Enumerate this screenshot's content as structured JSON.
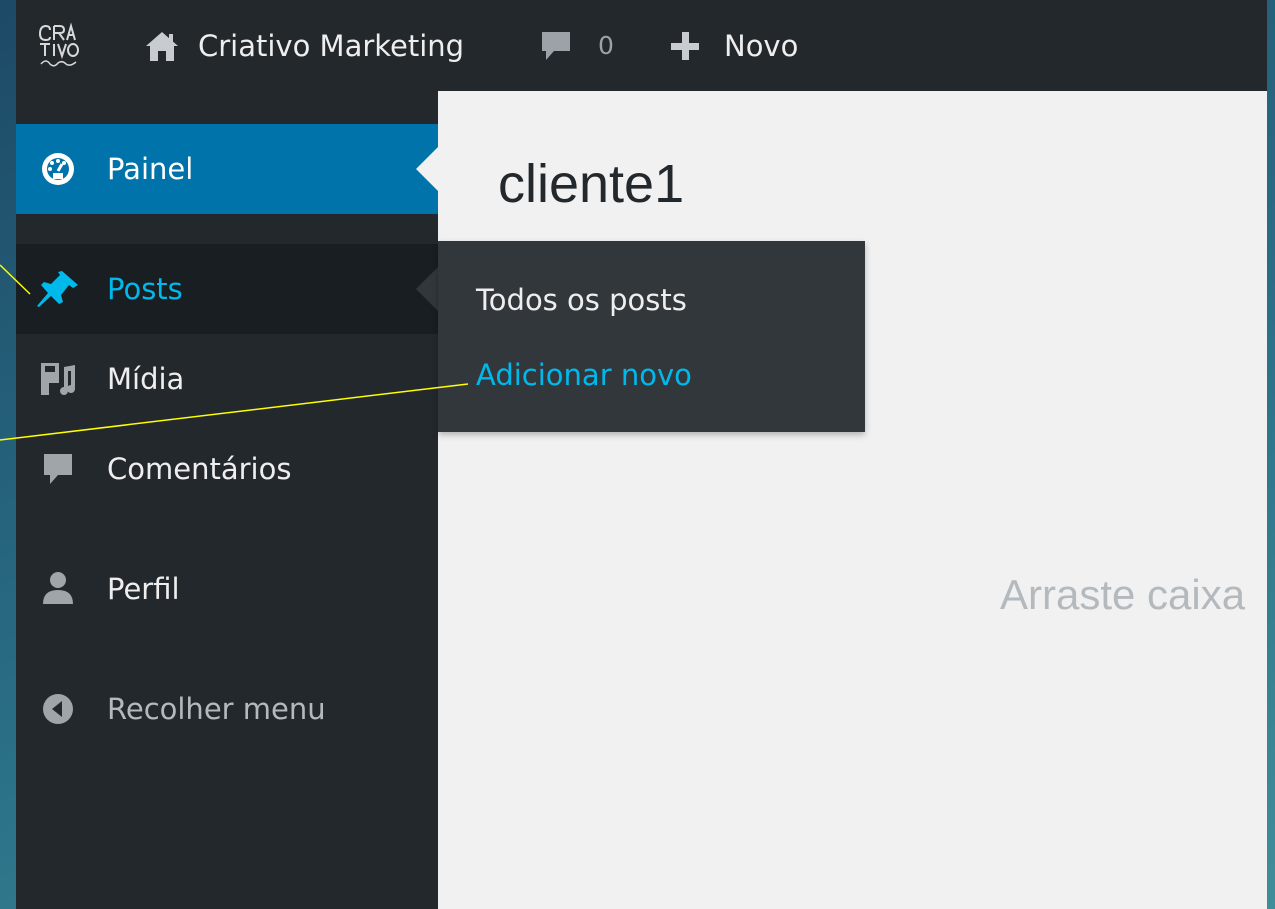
{
  "adminbar": {
    "logo_icon": "criativo-logo-icon",
    "site_name": "Criativo Marketing",
    "comments_count": "0",
    "new_label": "Novo"
  },
  "sidebar": {
    "items": [
      {
        "key": "painel",
        "label": "Painel",
        "icon": "dashboard-icon"
      },
      {
        "key": "posts",
        "label": "Posts",
        "icon": "pushpin-icon"
      },
      {
        "key": "midia",
        "label": "Mídia",
        "icon": "media-icon"
      },
      {
        "key": "comentarios",
        "label": "Comentários",
        "icon": "comment-icon"
      },
      {
        "key": "perfil",
        "label": "Perfil",
        "icon": "user-icon"
      },
      {
        "key": "recolher",
        "label": "Recolher menu",
        "icon": "collapse-icon"
      }
    ]
  },
  "flyout": {
    "items": [
      {
        "label": "Todos os posts"
      },
      {
        "label": "Adicionar novo"
      }
    ]
  },
  "main": {
    "title": "cliente1",
    "drop_hint": "Arraste caixa"
  },
  "colors": {
    "adminbar_bg": "#23282d",
    "sidebar_bg": "#23282d",
    "active_bg": "#0073aa",
    "submenu_bg": "#32373c",
    "highlight_text": "#00b9eb",
    "content_bg": "#f1f1f1",
    "annotation_line": "#ffff00"
  }
}
